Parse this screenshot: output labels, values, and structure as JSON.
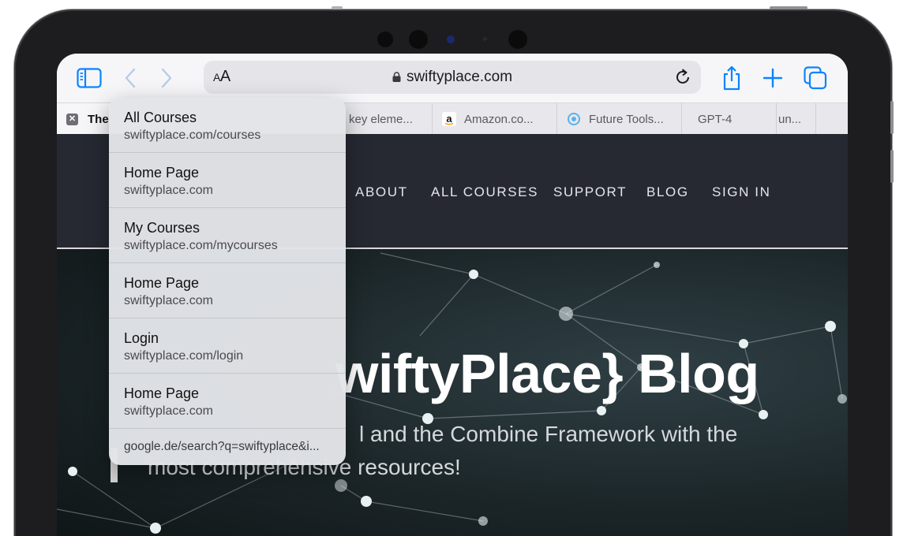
{
  "toolbar": {
    "text_size_label_small": "A",
    "text_size_label_large": "A",
    "url": "swiftyplace.com"
  },
  "tabs": [
    {
      "title": "The",
      "icon": "close-icon",
      "active": true
    },
    {
      "title": "key eleme...",
      "icon": "",
      "active": false
    },
    {
      "title": "Amazon.co...",
      "icon": "amazon-icon",
      "active": false
    },
    {
      "title": "Future Tools...",
      "icon": "future-tools-icon",
      "active": false
    },
    {
      "title": "GPT-4",
      "icon": "",
      "active": false
    },
    {
      "title": "un...",
      "icon": "",
      "active": false
    }
  ],
  "site": {
    "nav": [
      "ABOUT",
      "ALL COURSES",
      "SUPPORT",
      "BLOG",
      "SIGN IN"
    ],
    "hero_title": "wiftyPlace} Blog",
    "hero_subtitle_line1": "l and the Combine Framework with the",
    "hero_subtitle_line2": "most comprehensive resources!"
  },
  "suggestions": [
    {
      "title": "All Courses",
      "url": "swiftyplace.com/courses"
    },
    {
      "title": "Home Page",
      "url": "swiftyplace.com"
    },
    {
      "title": "My Courses",
      "url": "swiftyplace.com/mycourses"
    },
    {
      "title": "Home Page",
      "url": "swiftyplace.com"
    },
    {
      "title": "Login",
      "url": "swiftyplace.com/login"
    },
    {
      "title": "Home Page",
      "url": "swiftyplace.com"
    }
  ],
  "search_suggestion": "google.de/search?q=swiftyplace&i...",
  "colors": {
    "accent": "#0a84ff",
    "site_nav_bg": "#262932",
    "frame": "#1d1d1f"
  }
}
